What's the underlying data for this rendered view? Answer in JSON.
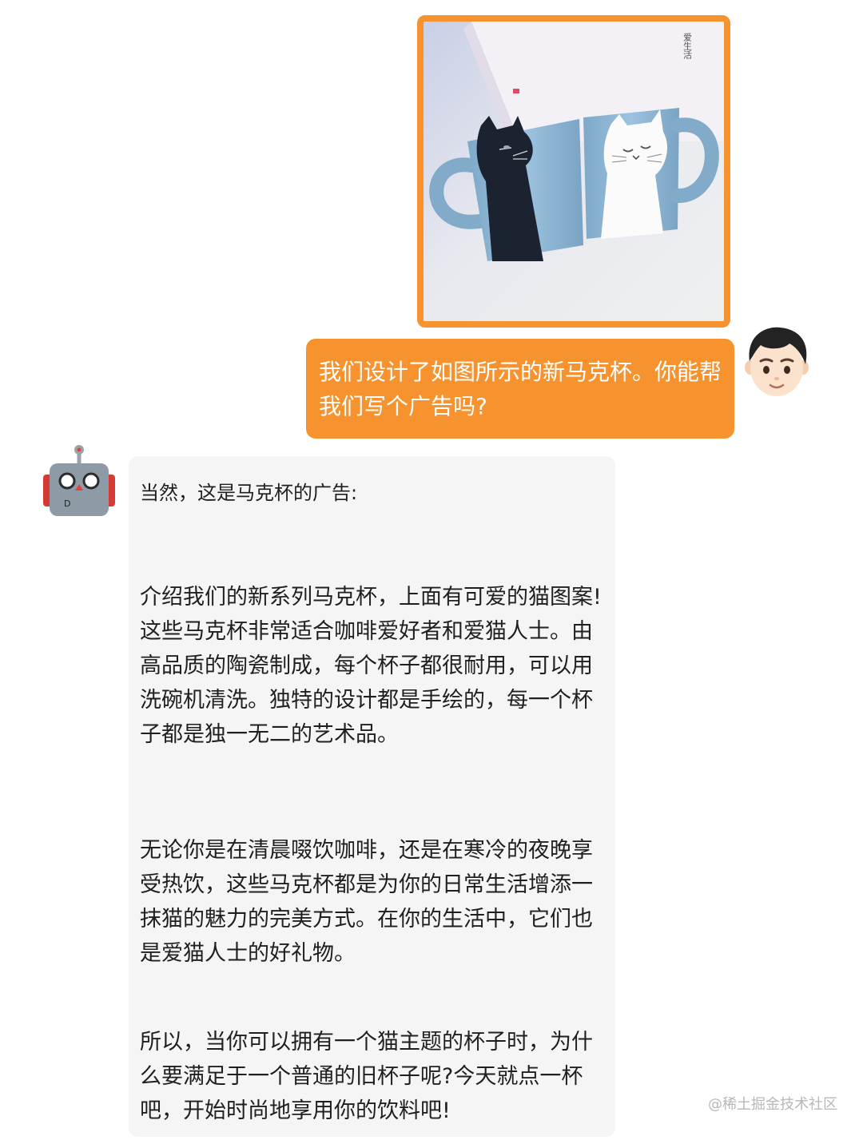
{
  "chat": {
    "user_image": {
      "caption_icon": "cat-mugs-photo",
      "box_text": "爱生活"
    },
    "user_message": "我们设计了如图所示的新马克杯。你能帮我们写个广告吗?",
    "bot_intro": "当然，这是马克杯的广告:",
    "bot_paragraphs": [
      "介绍我们的新系列马克杯，上面有可爱的猫图案!这些马克杯非常适合咖啡爱好者和爱猫人士。由高品质的陶瓷制成，每个杯子都很耐用，可以用洗碗机清洗。独特的设计都是手绘的，每一个杯子都是独一无二的艺术品。",
      "无论你是在清晨啜饮咖啡，还是在寒冷的夜晚享受热饮，这些马克杯都是为你的日常生活增添一抹猫的魅力的完美方式。在你的生活中，它们也是爱猫人士的好礼物。",
      "所以，当你可以拥有一个猫主题的杯子时，为什么要满足于一个普通的旧杯子呢?今天就点一杯吧，开始时尚地享用你的饮料吧!"
    ],
    "bot_badge": "D"
  },
  "watermark": "@稀土掘金技术社区",
  "colors": {
    "accent": "#f7932f",
    "bot_bubble": "#f5f5f5",
    "mug_blue": "#8fb7d6"
  }
}
